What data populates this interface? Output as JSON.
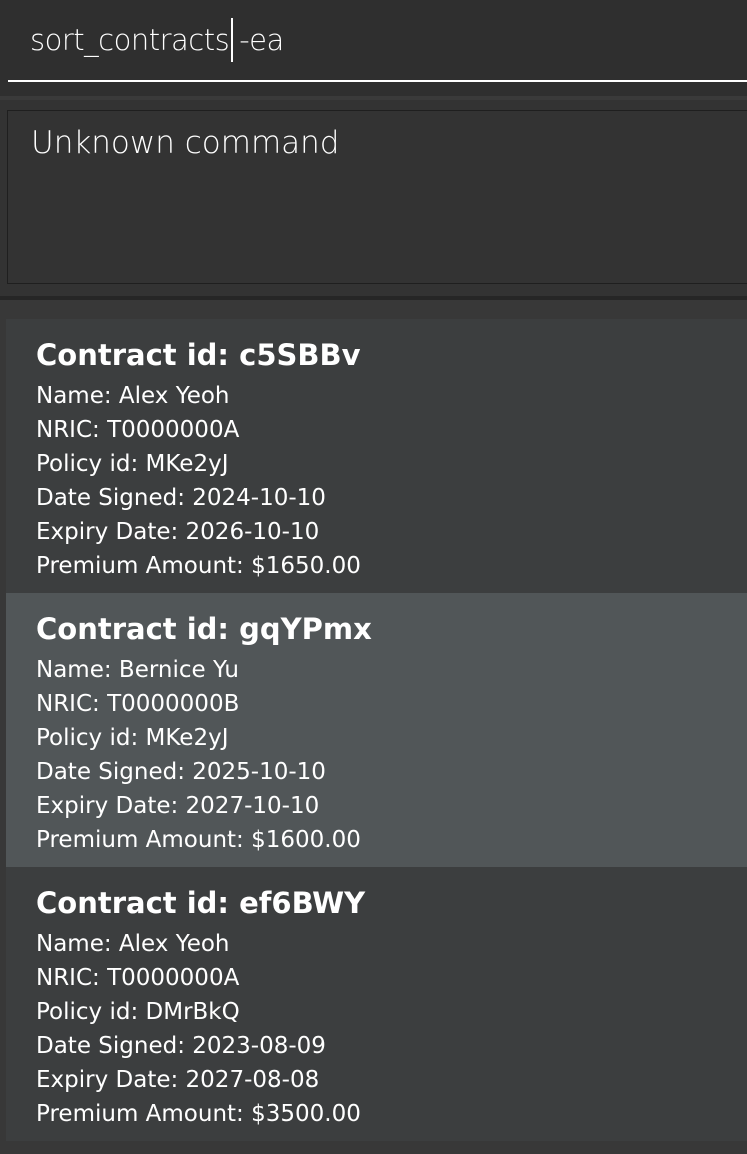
{
  "command_box": {
    "text_before_caret": "sort_contracts",
    "text_after_caret": "-ea"
  },
  "result_display": {
    "message": "Unknown command"
  },
  "contracts": [
    {
      "title": "Contract id: c5SBBv",
      "name": "Name: Alex Yeoh",
      "nric": "NRIC: T0000000A",
      "policy": "Policy id: MKe2yJ",
      "date_signed": "Date Signed: 2024-10-10",
      "expiry": "Expiry Date: 2026-10-10",
      "premium": "Premium Amount: $1650.00"
    },
    {
      "title": "Contract id: gqYPmx",
      "name": "Name: Bernice Yu",
      "nric": "NRIC: T0000000B",
      "policy": "Policy id: MKe2yJ",
      "date_signed": "Date Signed: 2025-10-10",
      "expiry": "Expiry Date: 2027-10-10",
      "premium": "Premium Amount: $1600.00"
    },
    {
      "title": "Contract id: ef6BWY",
      "name": "Name: Alex Yeoh",
      "nric": "NRIC: T0000000A",
      "policy": "Policy id: DMrBkQ",
      "date_signed": "Date Signed: 2023-08-09",
      "expiry": "Expiry Date: 2027-08-08",
      "premium": "Premium Amount: $3500.00"
    }
  ],
  "colors": {
    "background": "#2c2c2c",
    "card": "#3c3e3f",
    "card_selected": "#515658",
    "text": "#ffffff"
  }
}
